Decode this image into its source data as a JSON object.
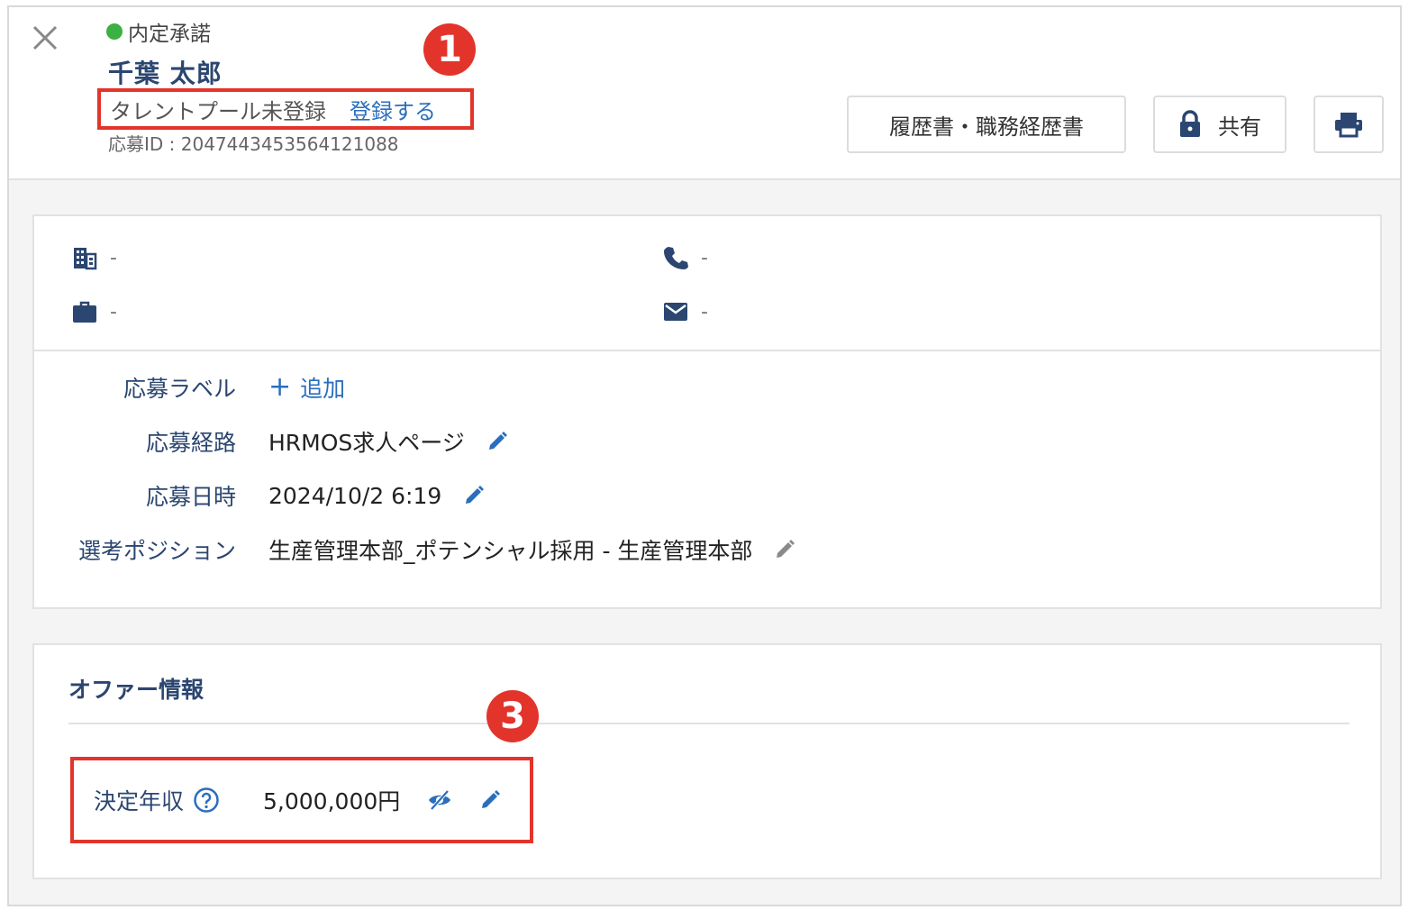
{
  "header": {
    "status_label": "内定承諾",
    "status_color": "#3cb043",
    "candidate_name": "千葉 太郎",
    "talent_pool_status": "タレントプール未登録",
    "talent_pool_register_link": "登録する",
    "application_id": "応募ID : 2047443453564121088",
    "resume_button": "履歴書・職務経歴書",
    "share_button": "共有",
    "icons": {
      "close": "close-icon",
      "share": "lock-icon",
      "print": "printer-icon"
    }
  },
  "annotations": {
    "badge_1": "1",
    "badge_3": "3",
    "highlight_color": "#e2342b"
  },
  "contact": {
    "company": "-",
    "job": "-",
    "phone": "-",
    "email": "-",
    "icons": {
      "company": "building-icon",
      "job": "briefcase-icon",
      "phone": "phone-icon",
      "email": "mail-icon"
    }
  },
  "application_details": {
    "label_row": {
      "label": "応募ラベル",
      "add": "追加"
    },
    "route_row": {
      "label": "応募経路",
      "value": "HRMOS求人ページ"
    },
    "date_row": {
      "label": "応募日時",
      "value": "2024/10/2 6:19"
    },
    "position_row": {
      "label": "選考ポジション",
      "value": "生産管理本部_ポテンシャル採用 - 生産管理本部"
    }
  },
  "offer": {
    "title": "オファー情報",
    "salary_label": "決定年収",
    "salary_value": "5,000,000円",
    "icons": {
      "help": "help-circle-icon",
      "visibility": "eye-off-icon",
      "edit": "pencil-icon"
    }
  },
  "colors": {
    "accent": "#2a6ebd",
    "label": "#2b4670"
  }
}
